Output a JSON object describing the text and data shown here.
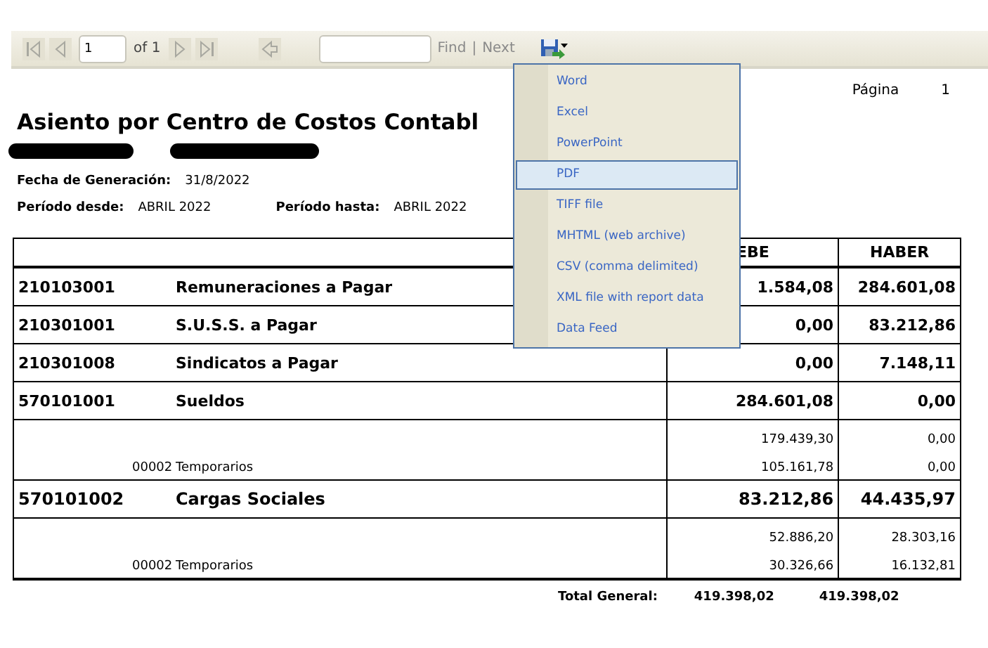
{
  "toolbar": {
    "nav_buttons": [
      {
        "kind": "first",
        "disabled": true
      },
      {
        "kind": "previous",
        "disabled": true
      }
    ],
    "page_value": "1",
    "page_count": "of 1",
    "nav_buttons_after": [
      {
        "kind": "next",
        "disabled": true
      },
      {
        "kind": "last",
        "disabled": true
      }
    ],
    "back_button": {
      "disabled": true
    },
    "find_label": "Find",
    "find_separator": "|",
    "next_label": "Next"
  },
  "export_menu": {
    "expanded": true,
    "items": [
      {
        "label": "Word",
        "selected": false
      },
      {
        "label": "Excel",
        "selected": false
      },
      {
        "label": "PowerPoint",
        "selected": false
      },
      {
        "label": "PDF",
        "selected": true
      },
      {
        "label": "TIFF file",
        "selected": false
      },
      {
        "label": "MHTML (web archive)",
        "selected": false
      },
      {
        "label": "CSV (comma delimited)",
        "selected": false
      },
      {
        "label": "XML file with report data",
        "selected": false
      },
      {
        "label": "Data Feed",
        "selected": false
      }
    ]
  },
  "report": {
    "page_label": "Página",
    "page_number": "1",
    "title": "Asiento por Centro de Costos Contabl",
    "redactions": [
      {
        "kind": "redaction"
      },
      {
        "kind": "redaction"
      }
    ],
    "fields": [
      {
        "label": "Fecha de Generación:",
        "value": "31/8/2022"
      },
      {
        "label": "Período desde:",
        "value": "ABRIL 2022"
      },
      {
        "label": "Período hasta:",
        "value": "ABRIL 2022"
      }
    ],
    "table": {
      "columns": [
        "EBE",
        "HABER"
      ],
      "rows": [
        {
          "kind": "account",
          "code": "210103001",
          "name": "Remuneraciones a Pagar",
          "debe": "1.584,08",
          "haber": "284.601,08"
        },
        {
          "kind": "account",
          "code": "210301001",
          "name": "S.U.S.S. a Pagar",
          "debe": "0,00",
          "haber": "83.212,86"
        },
        {
          "kind": "account",
          "code": "210301008",
          "name": "Sindicatos a Pagar",
          "debe": "0,00",
          "haber": "7.148,11"
        },
        {
          "kind": "account",
          "code": "570101001",
          "name": "Sueldos",
          "debe": "284.601,08",
          "haber": "0,00"
        },
        {
          "kind": "detail",
          "lines": [
            {
              "debe": "179.439,30",
              "haber": "0,00"
            },
            {
              "code": "00002",
              "name": "Temporarios",
              "debe": "105.161,78",
              "haber": "0,00"
            }
          ]
        },
        {
          "kind": "account",
          "code": "570101002",
          "name": "Cargas Sociales",
          "debe": "83.212,86",
          "haber": "44.435,97",
          "large": true
        },
        {
          "kind": "detail",
          "lines": [
            {
              "debe": "52.886,20",
              "haber": "28.303,16"
            },
            {
              "code": "00002",
              "name": "Temporarios",
              "debe": "30.326,66",
              "haber": "16.132,81"
            }
          ]
        }
      ],
      "total": {
        "label": "Total General:",
        "debe": "419.398,02",
        "haber": "419.398,02"
      }
    }
  }
}
